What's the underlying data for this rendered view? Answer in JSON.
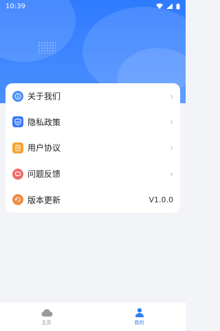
{
  "status_bar": {
    "time": "10:39"
  },
  "menu": {
    "items": [
      {
        "label": "关于我们",
        "icon": "info-icon",
        "color": "#4a90f7",
        "trailing": "›"
      },
      {
        "label": "隐私政策",
        "icon": "shield-icon",
        "color": "#3a7bfa",
        "trailing": "›"
      },
      {
        "label": "用户协议",
        "icon": "document-icon",
        "color": "#f4a430",
        "trailing": "›"
      },
      {
        "label": "问题反馈",
        "icon": "feedback-icon",
        "color": "#ef6a6a",
        "trailing": "›"
      },
      {
        "label": "版本更新",
        "icon": "update-icon",
        "color": "#f08b43",
        "trailing": "V1.0.0"
      }
    ]
  },
  "tabbar": {
    "home_label": "主页",
    "mine_label": "我的",
    "active": "mine",
    "active_color": "#2d7ff9",
    "inactive_color": "#8d8d8d"
  }
}
